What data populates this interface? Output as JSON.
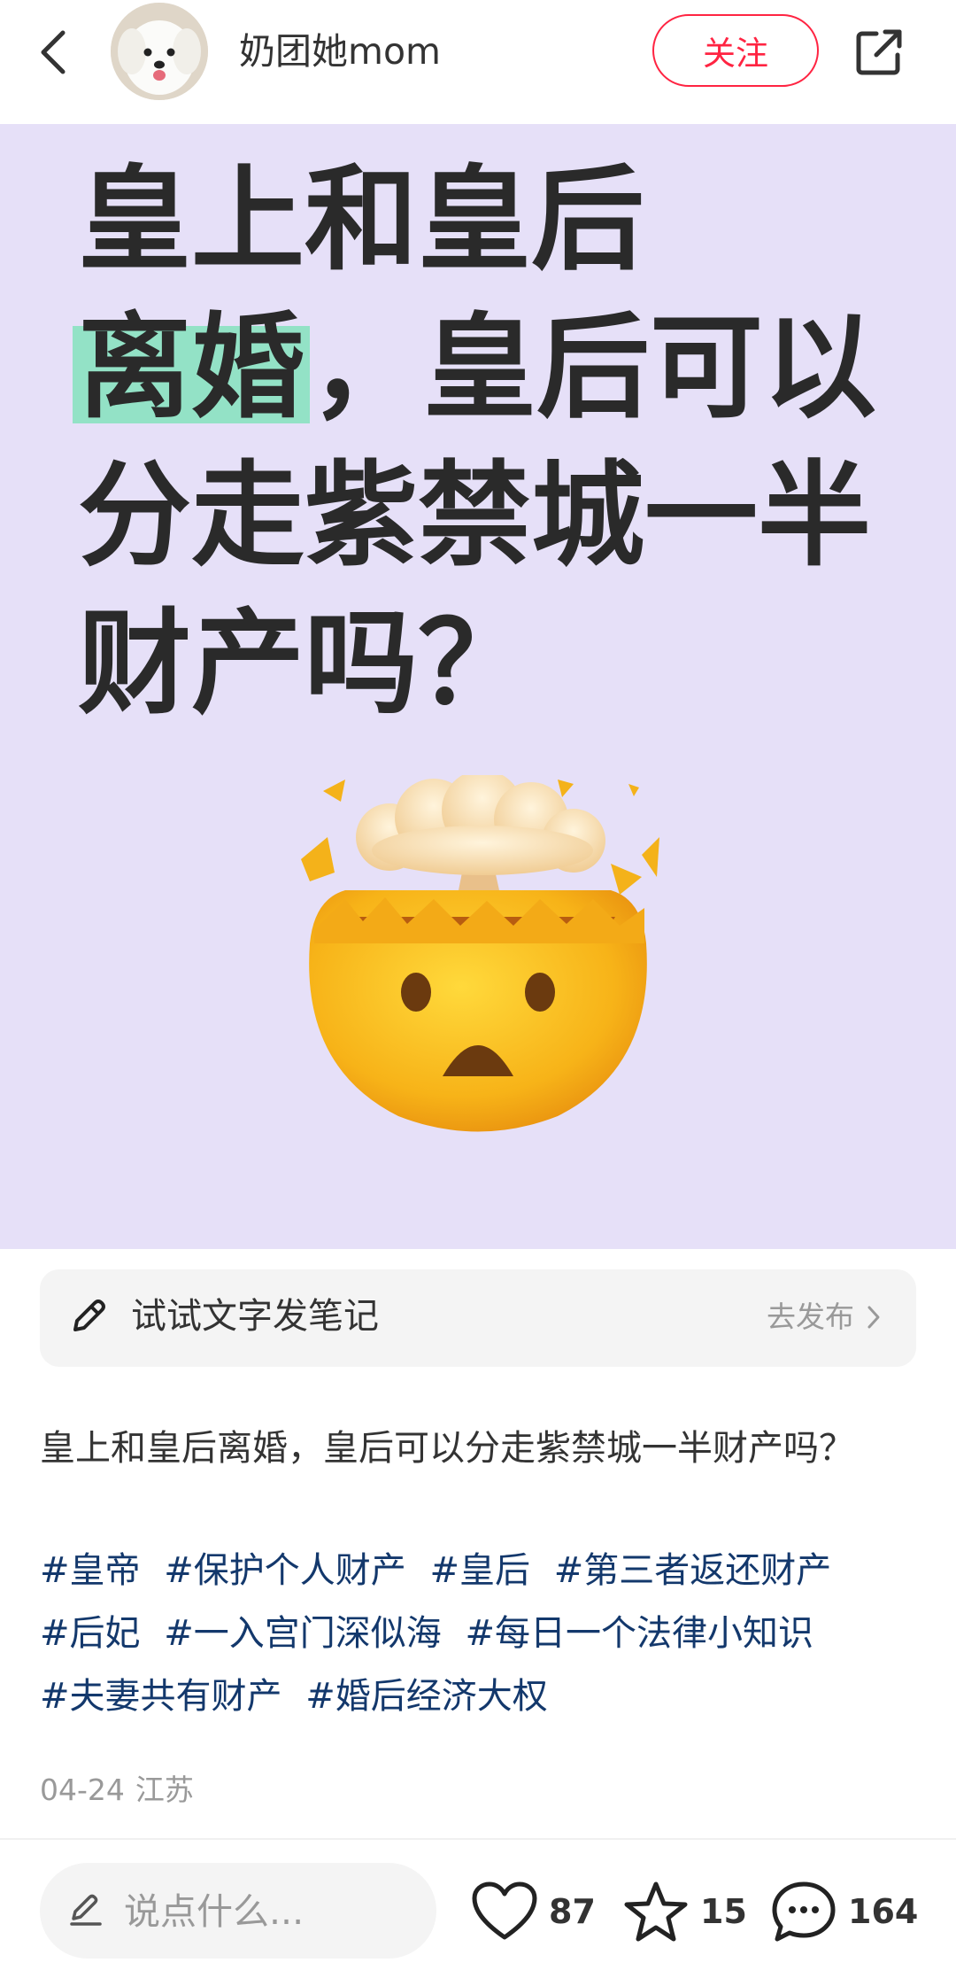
{
  "header": {
    "username": "奶团她mom",
    "follow_label": "关注"
  },
  "cover": {
    "title_lines": [
      "皇上和皇后",
      "离婚",
      "，皇后可以",
      "分走紫禁城一半",
      "财产吗？"
    ]
  },
  "composer": {
    "prompt": "试试文字发笔记",
    "action": "去发布"
  },
  "post": {
    "description": "皇上和皇后离婚，皇后可以分走紫禁城一半财产吗？",
    "tags": [
      "#皇帝",
      "#保护个人财产",
      "#皇后",
      "#第三者返还财产",
      "#后妃",
      "#一入宫门深似海",
      "#每日一个法律小知识",
      "#夫妻共有财产",
      "#婚后经济大权"
    ],
    "date": "04-24",
    "location": "江苏"
  },
  "bottom": {
    "comment_placeholder": "说点什么...",
    "likes": "87",
    "stars": "15",
    "comments": "164"
  },
  "colors": {
    "accent": "#ff2442",
    "cover_bg": "#e6e0f8",
    "highlight": "#93e2c6",
    "tag": "#13386c"
  },
  "icons": {
    "back": "chevron-left-icon",
    "share": "share-icon",
    "composer": "pencil-icon",
    "composer_action": "chevron-right-icon",
    "like": "heart-icon",
    "star": "star-icon",
    "comment": "comment-bubble-icon",
    "cover_emoji": "exploding-head-emoji"
  }
}
